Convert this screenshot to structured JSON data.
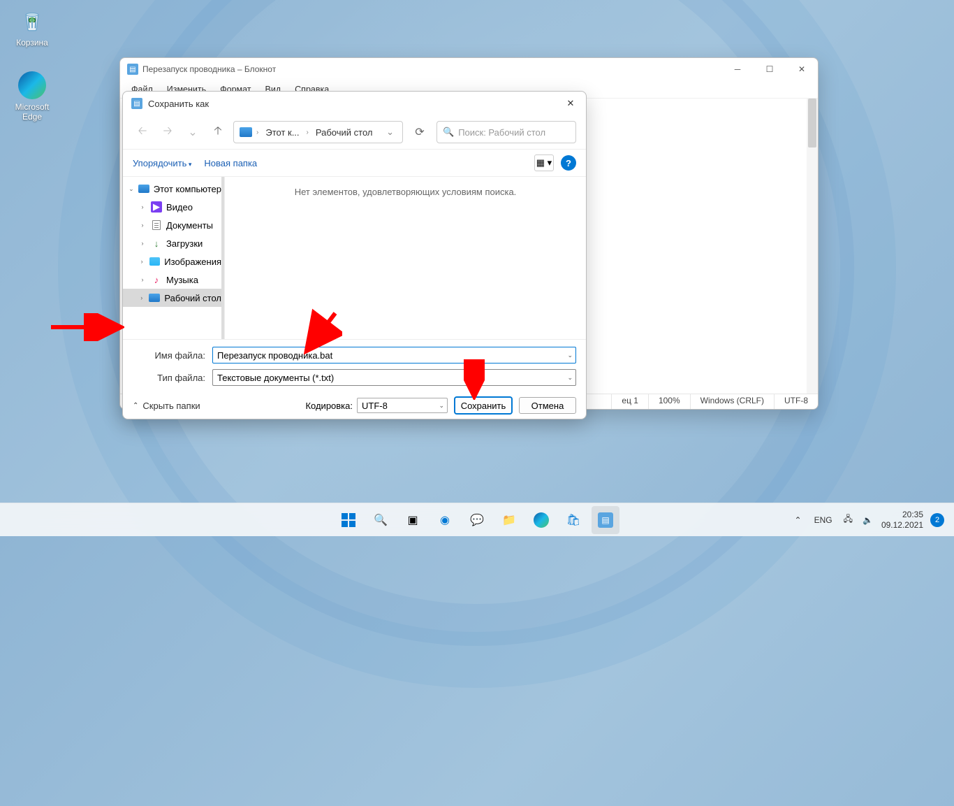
{
  "desktop_icons": {
    "recycle": "Корзина",
    "edge": "Microsoft Edge"
  },
  "notepad": {
    "title": "Перезапуск проводника – Блокнот",
    "menu": {
      "file": "Файл",
      "edit": "Изменить",
      "format": "Формат",
      "view": "Вид",
      "help": "Справка"
    },
    "status": {
      "pos": "ец 1",
      "zoom": "100%",
      "eol": "Windows (CRLF)",
      "enc": "UTF-8"
    }
  },
  "dialog": {
    "title": "Сохранить как",
    "breadcrumb": {
      "pc": "Этот к...",
      "desktop": "Рабочий стол"
    },
    "search_placeholder": "Поиск: Рабочий стол",
    "organize": "Упорядочить",
    "new_folder": "Новая папка",
    "tree": {
      "this_pc": "Этот компьютер",
      "video": "Видео",
      "documents": "Документы",
      "downloads": "Загрузки",
      "pictures": "Изображения",
      "music": "Музыка",
      "desktop": "Рабочий стол"
    },
    "empty_msg": "Нет элементов, удовлетворяющих условиям поиска.",
    "filename_label": "Имя файла:",
    "filename_value": "Перезапуск проводника.bat",
    "filetype_label": "Тип файла:",
    "filetype_value": "Текстовые документы (*.txt)",
    "hide_folders": "Скрыть папки",
    "encoding_label": "Кодировка:",
    "encoding_value": "UTF-8",
    "save_btn": "Сохранить",
    "cancel_btn": "Отмена"
  },
  "taskbar": {
    "lang": "ENG",
    "time": "20:35",
    "date": "09.12.2021",
    "notif_count": "2"
  }
}
